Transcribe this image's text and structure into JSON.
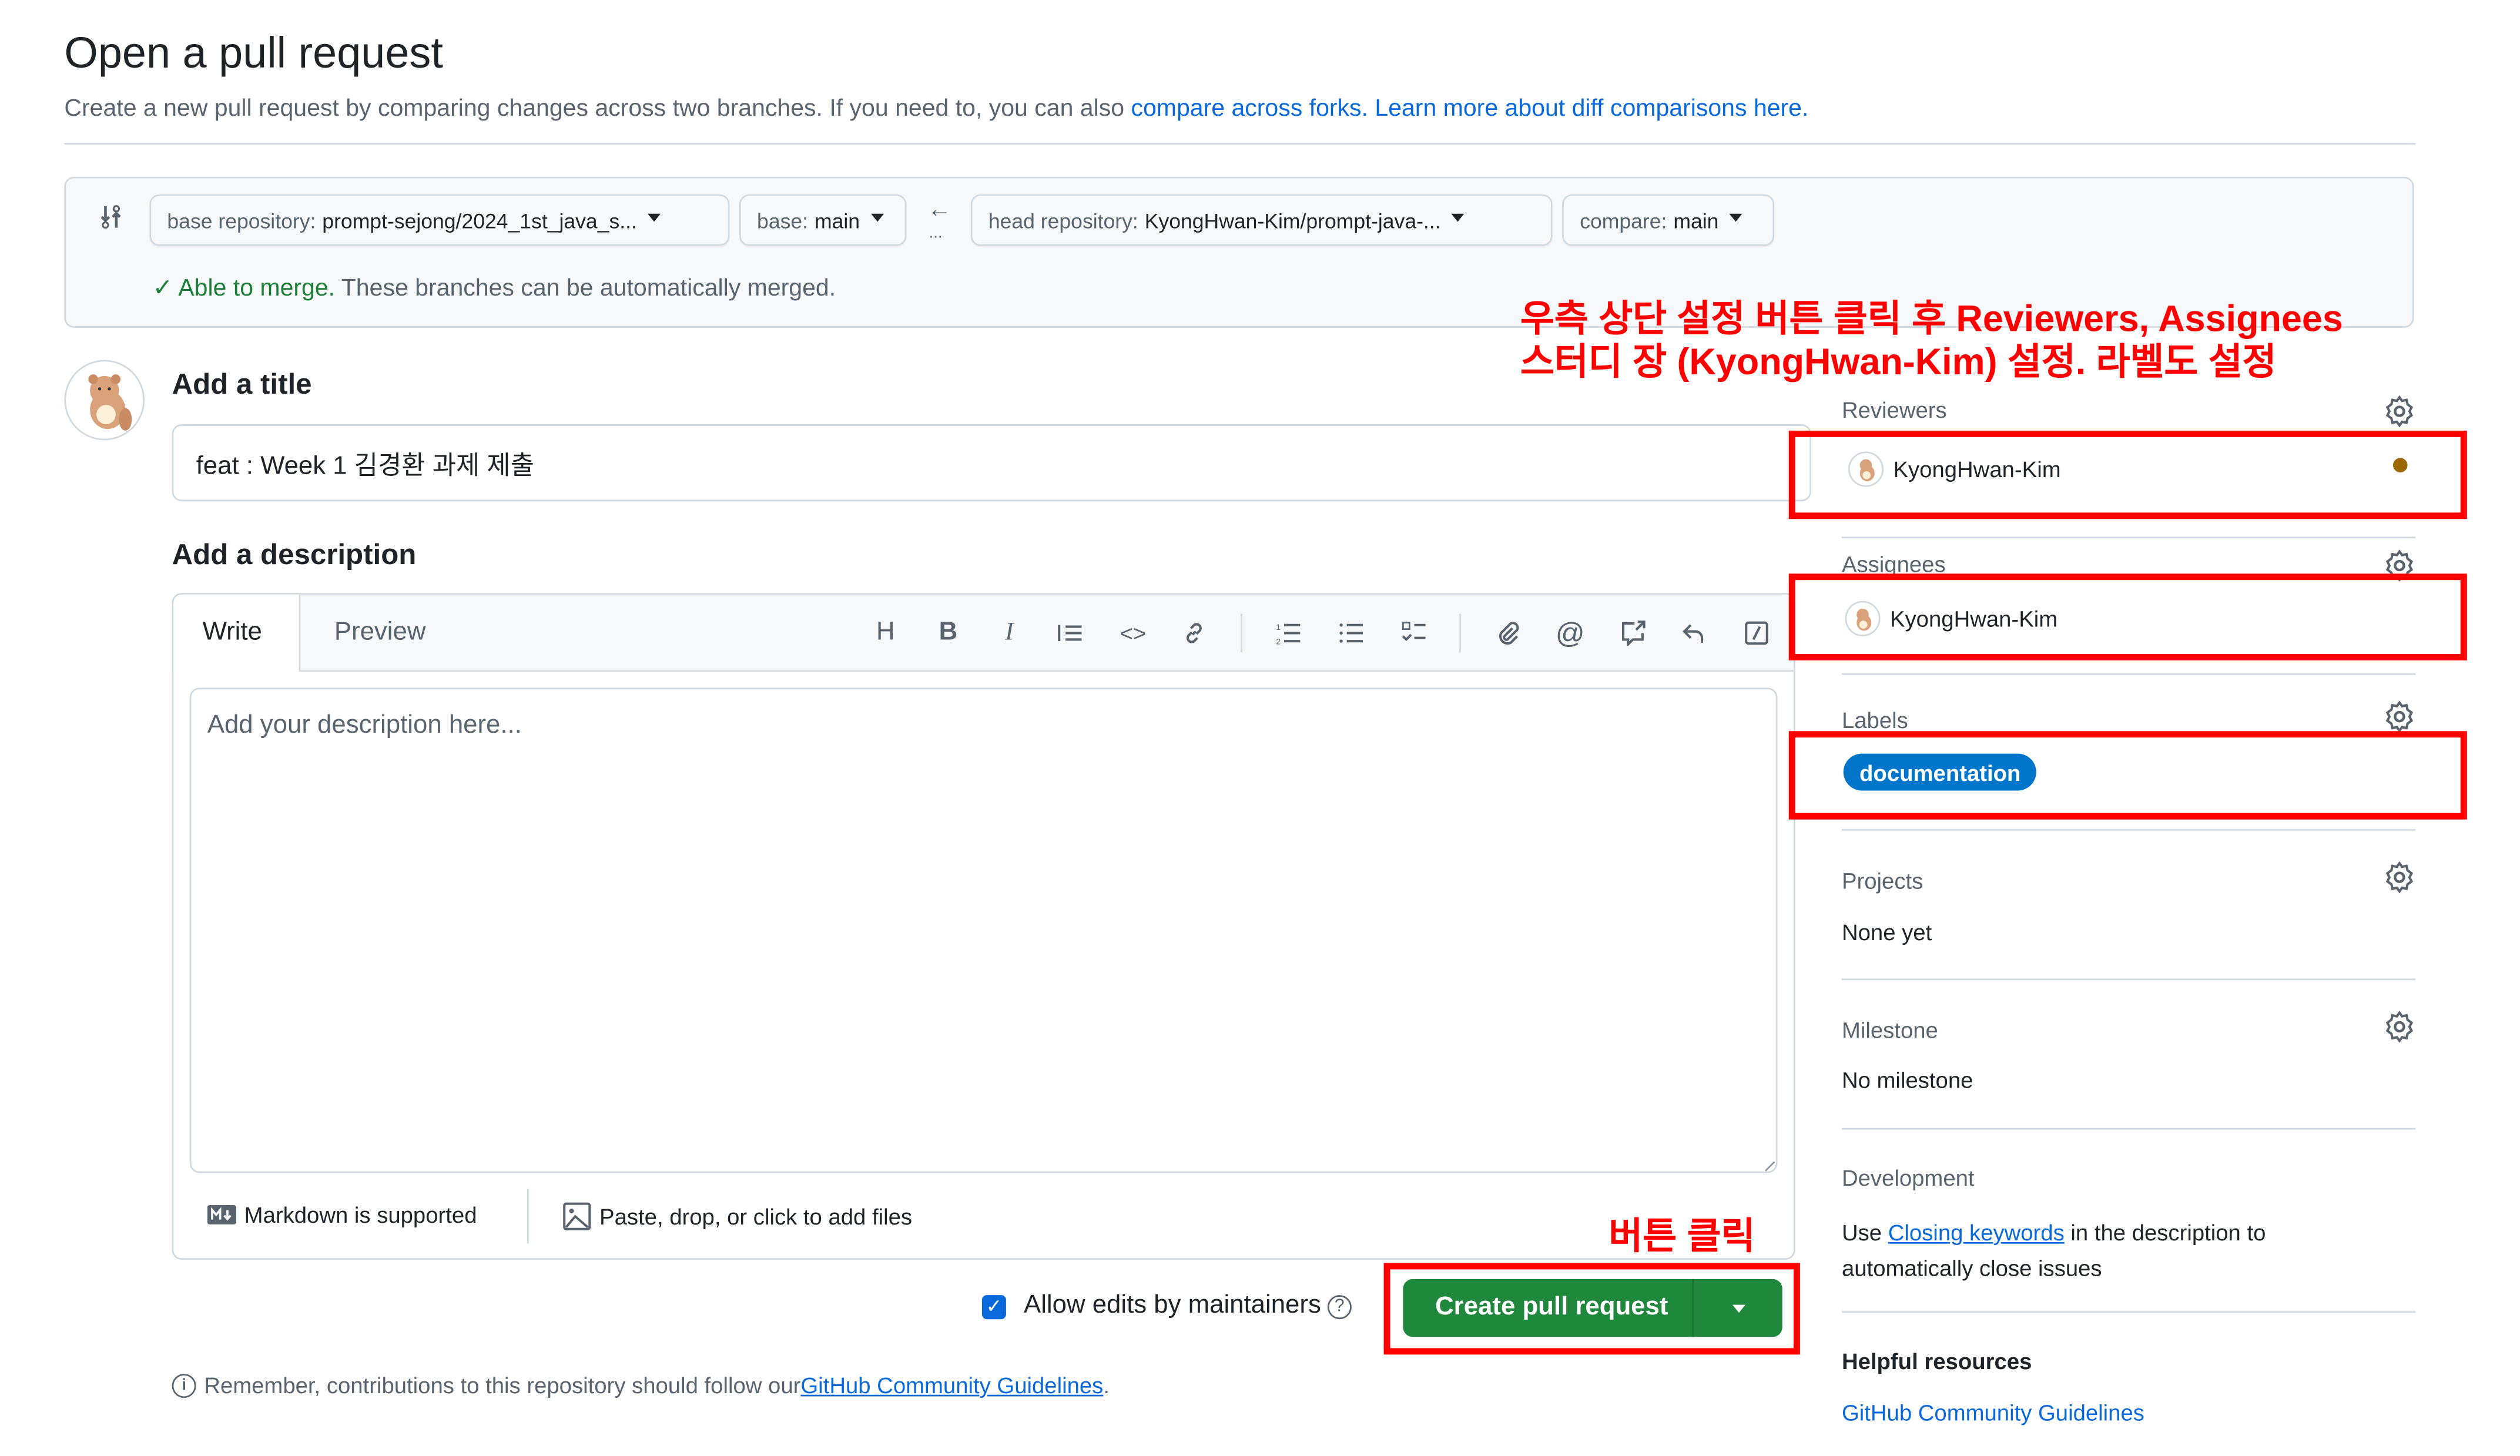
{
  "page": {
    "title": "Open a pull request",
    "subtitle_prefix": "Create a new pull request by comparing changes across two branches. If you need to, you can also ",
    "subtitle_link1": "compare across forks.",
    "subtitle_link2": "Learn more about diff comparisons here."
  },
  "compare": {
    "base_repo_label": "base repository:",
    "base_repo_value": "prompt-sejong/2024_1st_java_s...",
    "base_label": "base:",
    "base_value": "main",
    "head_repo_label": "head repository:",
    "head_repo_value": "KyongHwan-Kim/prompt-java-...",
    "compare_label": "compare:",
    "compare_value": "main",
    "arrow": "←",
    "dots": "...",
    "merge_ok": "✓ Able to merge.",
    "merge_text": " These branches can be automatically merged."
  },
  "form": {
    "title_label": "Add a title",
    "title_value": "feat : Week 1 김경환 과제 제출",
    "description_label": "Add a description",
    "tabs": [
      "Write",
      "Preview"
    ],
    "toolbar": [
      {
        "icon": "heading-icon",
        "glyph": "H"
      },
      {
        "icon": "bold-icon",
        "glyph": "B"
      },
      {
        "icon": "italic-icon",
        "glyph": "I"
      },
      {
        "icon": "quote-icon",
        "glyph": "❝"
      },
      {
        "icon": "code-icon",
        "glyph": "<>"
      },
      {
        "icon": "link-icon",
        "glyph": "🔗"
      },
      {
        "icon": "numbered-list-icon",
        "glyph": "≡"
      },
      {
        "icon": "bullet-list-icon",
        "glyph": "☰"
      },
      {
        "icon": "task-list-icon",
        "glyph": "☑"
      },
      {
        "icon": "attach-icon",
        "glyph": "📎"
      },
      {
        "icon": "mention-icon",
        "glyph": "@"
      },
      {
        "icon": "cross-reference-icon",
        "glyph": "↗"
      },
      {
        "icon": "reply-icon",
        "glyph": "↶"
      },
      {
        "icon": "slash-commands-icon",
        "glyph": "⧄"
      }
    ],
    "description_placeholder": "Add your description here...",
    "markdown_note": "Markdown is supported",
    "files_note": "Paste, drop, or click to add files",
    "allow_edits_label": "Allow edits by maintainers",
    "allow_edits_checked": true,
    "create_button": "Create pull request",
    "remember_prefix": "Remember, contributions to this repository should follow our ",
    "remember_link": "GitHub Community Guidelines",
    "remember_suffix": "."
  },
  "sidebar": {
    "reviewers": {
      "title": "Reviewers",
      "user": "KyongHwan-Kim",
      "status_color": "#9a6700"
    },
    "assignees": {
      "title": "Assignees",
      "user": "KyongHwan-Kim"
    },
    "labels": {
      "title": "Labels",
      "label": "documentation",
      "label_color": "#0075ca"
    },
    "projects": {
      "title": "Projects",
      "value": "None yet"
    },
    "milestone": {
      "title": "Milestone",
      "value": "No milestone"
    },
    "development": {
      "title": "Development",
      "prefix": "Use ",
      "link": "Closing keywords",
      "suffix": " in the description to automatically close issues"
    },
    "helpful": {
      "title": "Helpful resources",
      "link": "GitHub Community Guidelines"
    }
  },
  "annotations": {
    "top_line1": "우측 상단 설정 버튼 클릭 후 Reviewers, Assignees",
    "top_line2": "스터디 장 (KyongHwan-Kim) 설정.  라벨도 설정",
    "button_note": "버튼 클릭"
  }
}
